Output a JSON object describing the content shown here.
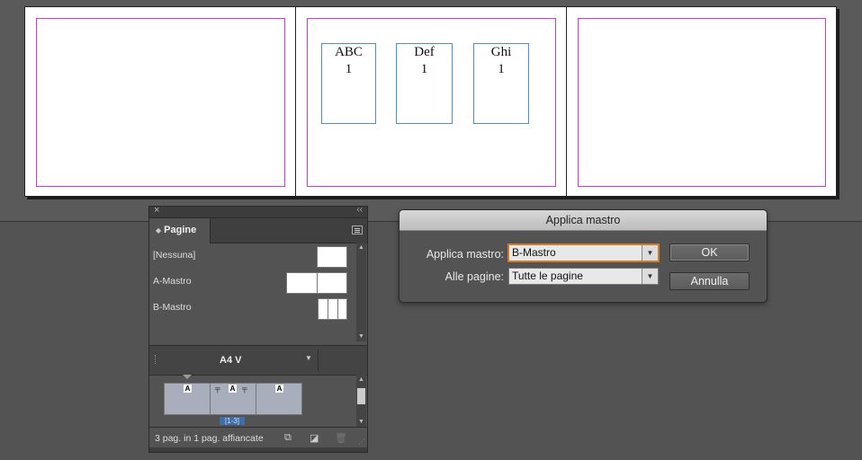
{
  "spread": {
    "frames": [
      {
        "title": "ABC",
        "number": "1"
      },
      {
        "title": "Def",
        "number": "1"
      },
      {
        "title": "Ghi",
        "number": "1"
      }
    ]
  },
  "pages_panel": {
    "close_glyph": "×",
    "collapse_glyph": "‹‹",
    "tab_label": "Pagine",
    "masters": [
      {
        "label": "[Nessuna]"
      },
      {
        "label": "A-Mastro"
      },
      {
        "label": "B-Mastro"
      }
    ],
    "page_size": "A4 V",
    "pages": [
      {
        "master": "A"
      },
      {
        "master": "A"
      },
      {
        "master": "A"
      }
    ],
    "spread_label": "[1-3]",
    "status": "3 pag. in 1 pag. affiancate"
  },
  "dialog": {
    "title": "Applica mastro",
    "apply_master_label": "Applica mastro:",
    "apply_master_value": "B-Mastro",
    "pages_label": "Alle pagine:",
    "pages_value": "Tutte le pagine",
    "ok_label": "OK",
    "cancel_label": "Annulla"
  },
  "colors": {
    "margin_guide": "#c83dd6",
    "frame_edge": "#4c8fd6",
    "focus_ring": "#d07b2a"
  }
}
